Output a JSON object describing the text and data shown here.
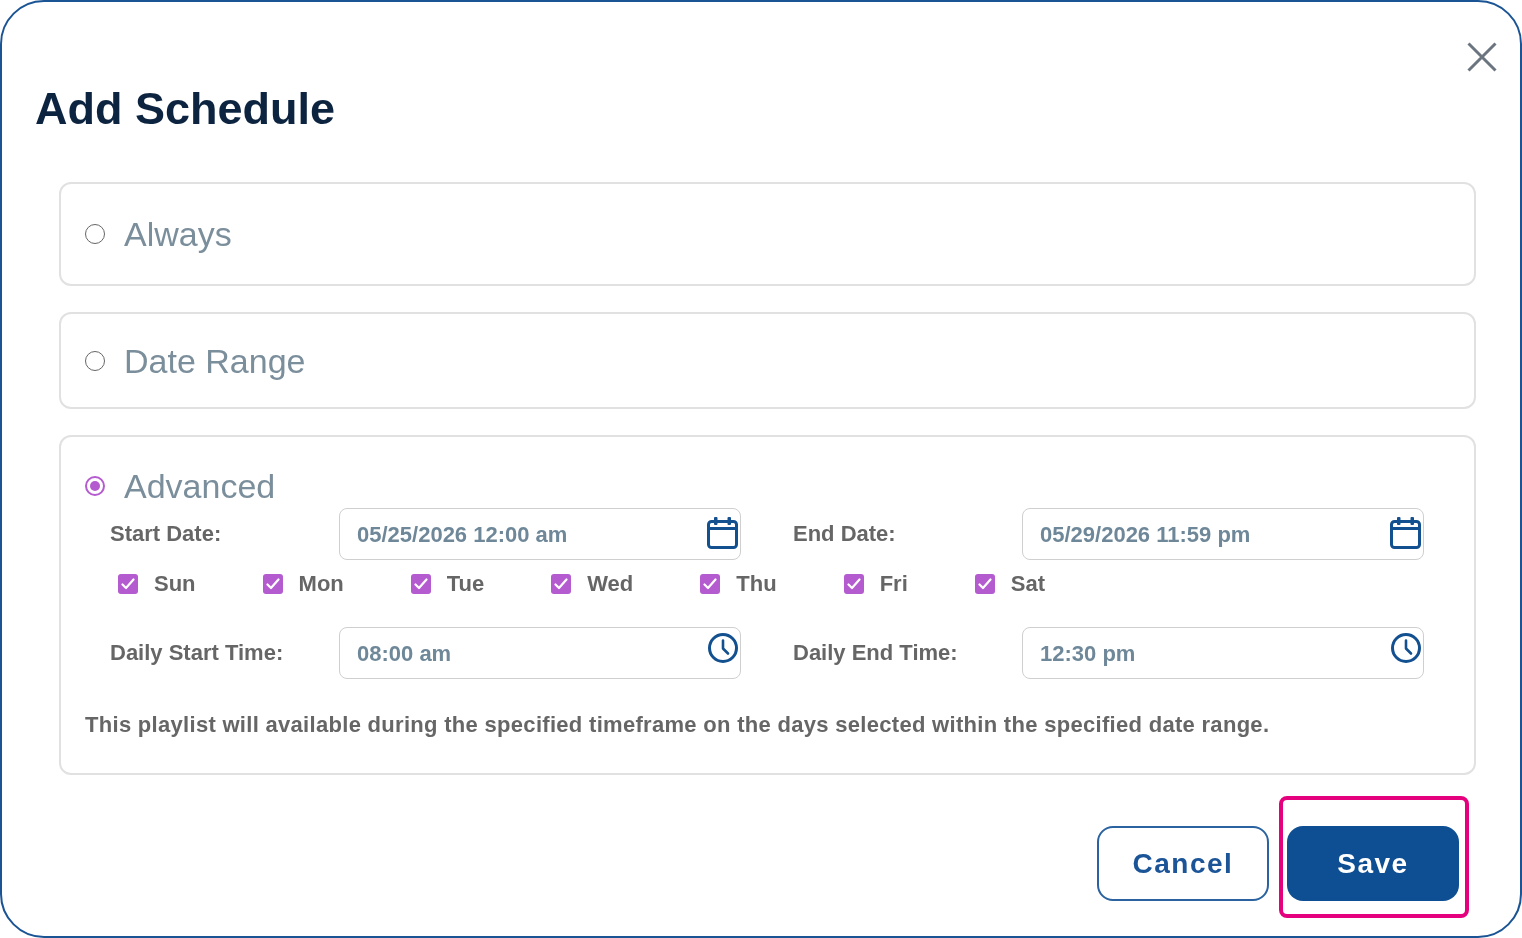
{
  "dialog": {
    "title": "Add Schedule"
  },
  "options": [
    {
      "label": "Always",
      "selected": false
    },
    {
      "label": "Date Range",
      "selected": false
    },
    {
      "label": "Advanced",
      "selected": true,
      "settings": {
        "date_fields": [
          {
            "label": "Start Date:",
            "value": "05/25/2026 12:00 am",
            "kind": "date"
          },
          {
            "label": "End Date:",
            "value": "05/29/2026 11:59 pm",
            "kind": "date"
          }
        ],
        "days": [
          {
            "label": "Sun",
            "checked": true
          },
          {
            "label": "Mon",
            "checked": true
          },
          {
            "label": "Tue",
            "checked": true
          },
          {
            "label": "Wed",
            "checked": true
          },
          {
            "label": "Thu",
            "checked": true
          },
          {
            "label": "Fri",
            "checked": true
          },
          {
            "label": "Sat",
            "checked": true
          }
        ],
        "time_fields": [
          {
            "label": "Daily Start Time:",
            "value": "08:00 am",
            "kind": "time"
          },
          {
            "label": "Daily End Time:",
            "value": "12:30 pm",
            "kind": "time"
          }
        ],
        "note": "This playlist will available during the specified timeframe on the days selected within the specified date range."
      }
    }
  ],
  "buttons": [
    {
      "label": "Cancel",
      "kind": "secondary",
      "highlighted": false
    },
    {
      "label": "Save",
      "kind": "primary",
      "highlighted": true
    }
  ]
}
